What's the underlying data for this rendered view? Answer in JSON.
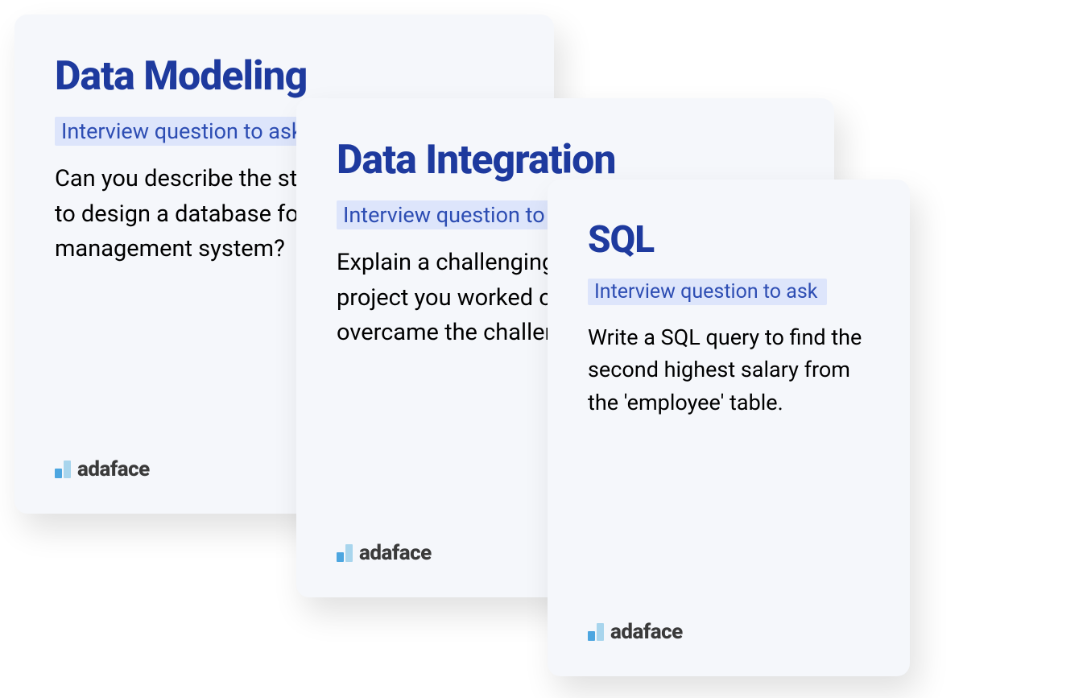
{
  "cards": [
    {
      "title": "Data Modeling",
      "subtitle": "Interview question to ask",
      "body": "Can you describe the steps you would take to design a database for a new inventory management system?"
    },
    {
      "title": "Data Integration",
      "subtitle": "Interview question to ask",
      "body": "Explain a challenging data integration project you worked on and how you overcame the challenges."
    },
    {
      "title": "SQL",
      "subtitle": "Interview question to ask",
      "body": "Write a SQL query to find the second highest salary from the 'employee' table."
    }
  ],
  "logo": {
    "text": "adaface"
  }
}
